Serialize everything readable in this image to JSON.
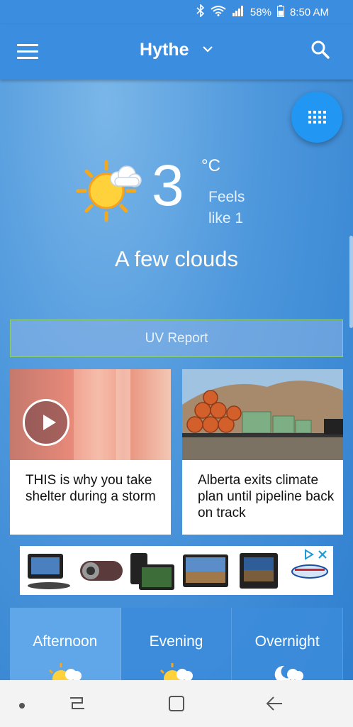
{
  "status_bar": {
    "battery": "58%",
    "time": "8:50 AM"
  },
  "header": {
    "location": "Hythe"
  },
  "current": {
    "temperature": "3",
    "unit": "°C",
    "feels_like": "Feels like 1",
    "condition": "A few clouds"
  },
  "uv_button": "UV Report",
  "news": [
    {
      "headline": "THIS is why you take shelter during a storm"
    },
    {
      "headline": "Alberta exits climate plan until pipeline back on track"
    }
  ],
  "periods": [
    {
      "label": "Afternoon",
      "icon": "sun-cloud-icon"
    },
    {
      "label": "Evening",
      "icon": "sun-cloud-icon"
    },
    {
      "label": "Overnight",
      "icon": "moon-cloud-icon"
    }
  ],
  "colors": {
    "app_bar": "#3b8de0",
    "fab": "#2196f3",
    "uv_border": "#8ccf6f"
  }
}
